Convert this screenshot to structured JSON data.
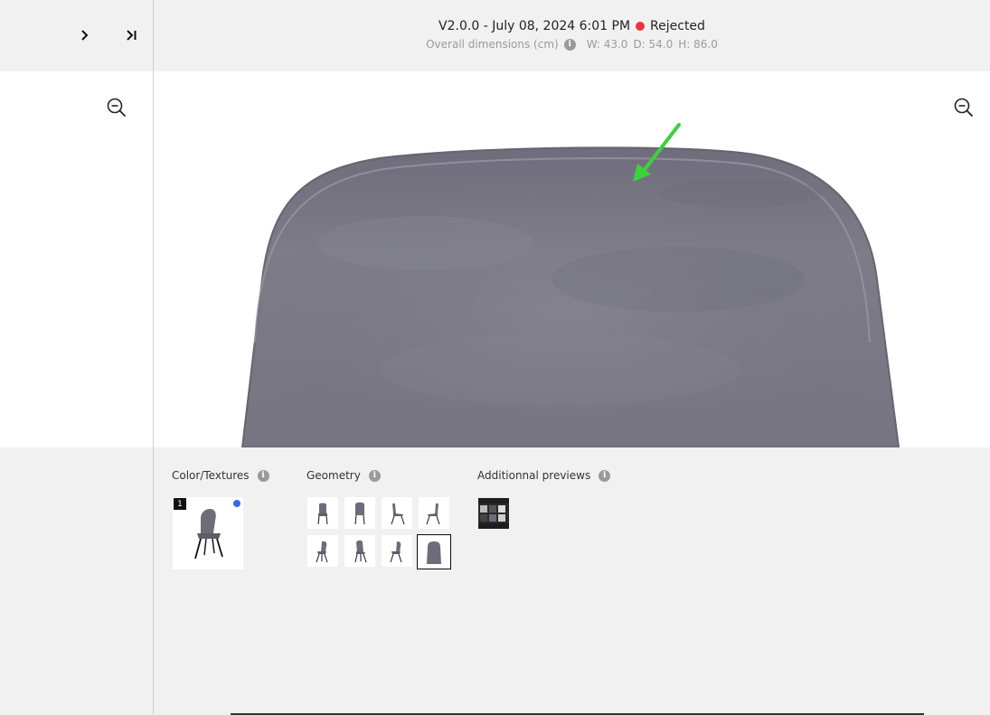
{
  "header": {
    "version": "V2.0.0 - July 08, 2024 6:01 PM",
    "status": "Rejected",
    "status_color": "#e5383b",
    "dimensions_label": "Overall dimensions (cm)",
    "width": "W: 43.0",
    "depth": "D: 54.0",
    "height": "H: 86.0"
  },
  "colors": {
    "chair_fabric": "#7a7885",
    "arrow": "#3bd23b",
    "selected_dot": "#2f6fe4"
  },
  "sections": {
    "textures": {
      "title": "Color/Textures",
      "items": [
        {
          "badge": "1"
        }
      ]
    },
    "geometry": {
      "title": "Geometry"
    },
    "previews": {
      "title": "Additionnal previews"
    }
  }
}
